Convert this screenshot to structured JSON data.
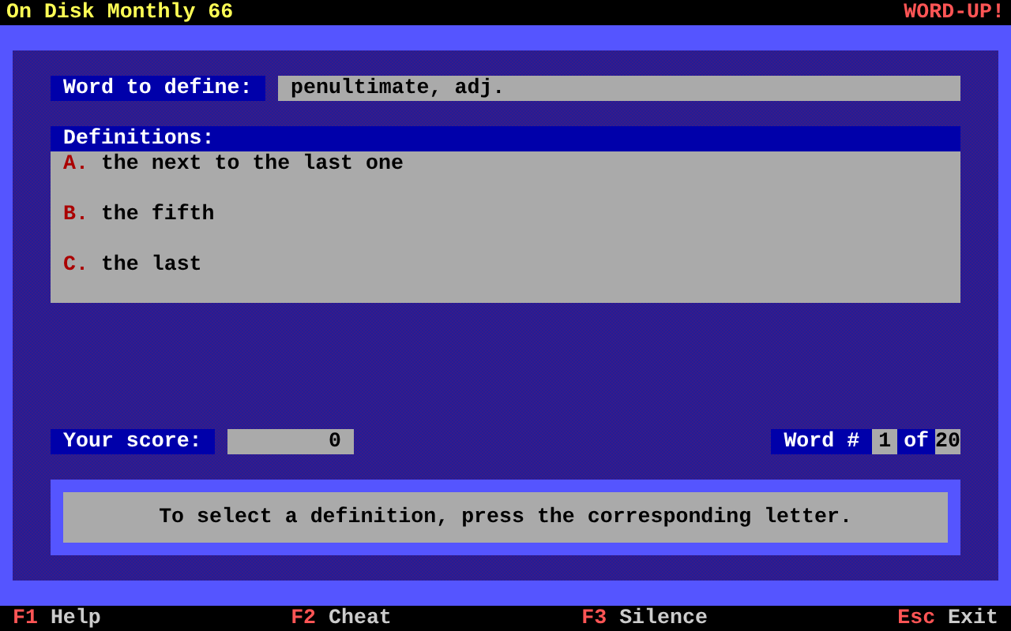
{
  "title_bar": {
    "title": "On Disk Monthly 66",
    "brand": "WORD-UP!"
  },
  "word": {
    "label": "Word to define:",
    "value": "penultimate, adj."
  },
  "definitions": {
    "label": "Definitions:",
    "items": [
      {
        "letter": "A.",
        "text": "the next to the last one"
      },
      {
        "letter": "B.",
        "text": "the fifth"
      },
      {
        "letter": "C.",
        "text": "the last"
      }
    ]
  },
  "score": {
    "label": "Your score:",
    "value": "0"
  },
  "word_number": {
    "label": "Word #",
    "current": "1",
    "separator": "of",
    "total": "20"
  },
  "message": "To select a definition, press the corresponding letter.",
  "function_keys": [
    {
      "key": "F1",
      "label": "Help"
    },
    {
      "key": "F2",
      "label": "Cheat"
    },
    {
      "key": "F3",
      "label": "Silence"
    },
    {
      "key": "Esc",
      "label": "Exit"
    }
  ]
}
